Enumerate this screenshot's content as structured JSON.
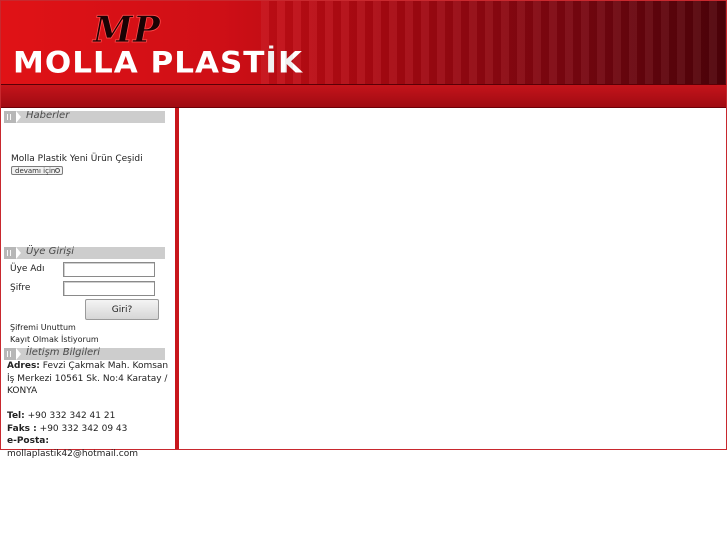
{
  "header": {
    "logo_mark": "MP",
    "brand": "MOLLA PLASTİK"
  },
  "sections": {
    "news": {
      "title": "Haberler",
      "item_text": "Molla Plastik Yeni Ürün Çeşidi",
      "more_button": "devamı için"
    },
    "login": {
      "title": "Üye Girişi",
      "username_label": "Üye Adı",
      "password_label": "Şifre",
      "username_value": "",
      "password_value": "",
      "submit_label": "Giri?",
      "forgot_link": "Şifremi Unuttum",
      "register_link": "Kayıt Olmak İstiyorum"
    },
    "contact": {
      "title": "İletişm Bilgileri",
      "address_label": "Adres:",
      "address_value": "Fevzi Çakmak Mah. Komsan İş Merkezi 10561 Sk. No:4 Karatay / KONYA",
      "phone_label": "Tel:",
      "phone_value": "+90 332 342 41 21",
      "fax_label": "Faks :",
      "fax_value": "+90 332 342 09 43",
      "email_label": "e-Posta:",
      "email_value": "mollaplastik42@hotmail.com"
    }
  },
  "colors": {
    "brand_red": "#d0131a",
    "dark_red": "#4e0209",
    "section_gray": "#cdcdcd"
  }
}
